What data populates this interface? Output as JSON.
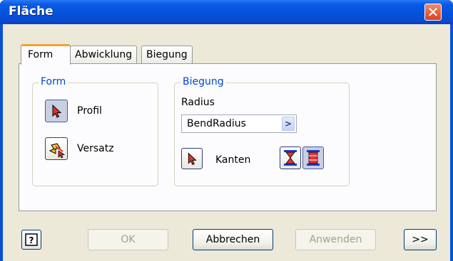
{
  "window": {
    "title": "Fläche",
    "close_glyph": "✕"
  },
  "tabs": [
    "Form",
    "Abwicklung",
    "Biegung"
  ],
  "form_group": {
    "title": "Form",
    "profile_label": "Profil",
    "offset_label": "Versatz"
  },
  "bend_group": {
    "title": "Biegung",
    "radius_label": "Radius",
    "radius_value": "BendRadius",
    "edges_label": "Kanten"
  },
  "footer": {
    "ok": "OK",
    "cancel": "Abbrechen",
    "apply": "Anwenden",
    "more": ">>"
  },
  "icons": {
    "help": "help-icon",
    "select": "cursor-arrow-icon",
    "offset": "offset-icon",
    "edge_mode_1": "edge-mode-icon",
    "edge_mode_2": "edge-mode-alt-icon"
  },
  "colors": {
    "title_bar": "#0552de",
    "group_title": "#0046d5",
    "active_tab_accent": "#f1a330",
    "close": "#d9401f"
  }
}
